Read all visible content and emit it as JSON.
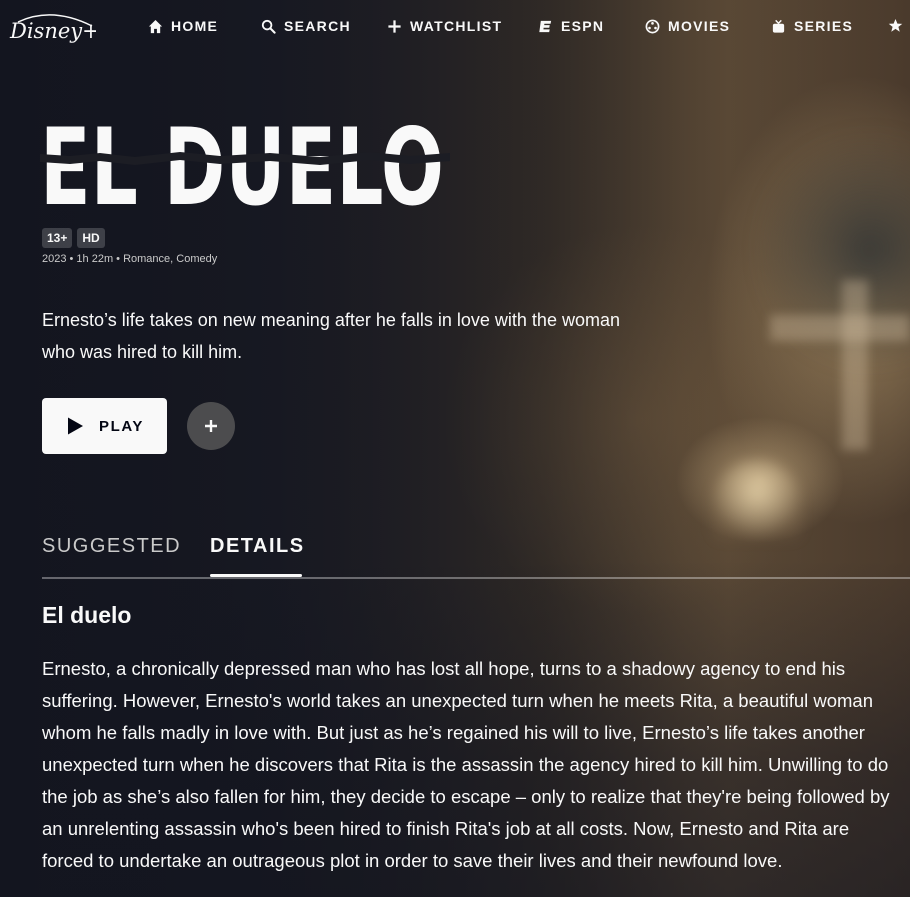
{
  "app": {
    "logo_text": "Disney+"
  },
  "nav": {
    "items": [
      {
        "label": "HOME",
        "icon": "home-icon"
      },
      {
        "label": "SEARCH",
        "icon": "search-icon"
      },
      {
        "label": "WATCHLIST",
        "icon": "plus-icon"
      },
      {
        "label": "ESPN",
        "icon": "espn-icon"
      },
      {
        "label": "MOVIES",
        "icon": "film-reel-icon"
      },
      {
        "label": "SERIES",
        "icon": "tv-icon"
      }
    ],
    "overflow_icon": "star-icon"
  },
  "title": {
    "art_text": "EL DUELO"
  },
  "badges": [
    "13+",
    "HD"
  ],
  "meta": "2023 • 1h 22m • Romance, Comedy",
  "description": "Ernesto’s life takes on new meaning after he falls in love with the woman who was hired to kill him.",
  "actions": {
    "play_label": "PLAY",
    "add_icon": "plus-icon"
  },
  "tabs": [
    {
      "label": "SUGGESTED",
      "active": false
    },
    {
      "label": "DETAILS",
      "active": true
    }
  ],
  "details": {
    "title": "El duelo",
    "body": "Ernesto, a chronically depressed man who has lost all hope, turns to a shadowy agency to end his suffering. However, Ernesto's world takes an unexpected turn when he meets Rita, a beautiful woman whom he falls madly in love with. But just as he’s regained his will to live, Ernesto’s life takes another unexpected turn when he discovers that Rita is the assassin the agency hired to kill him. Unwilling to do the job as she’s also fallen for him, they decide to escape – only to realize that they're being followed by an unrelenting assassin who's been hired to finish Rita's job at all costs. Now, Ernesto and Rita are forced to undertake an outrageous plot in order to save their lives and their newfound love."
  },
  "colors": {
    "background": "#1a1d29",
    "text": "#f9f9f9",
    "button_bg": "#f9f9f9",
    "button_text": "#040714"
  }
}
